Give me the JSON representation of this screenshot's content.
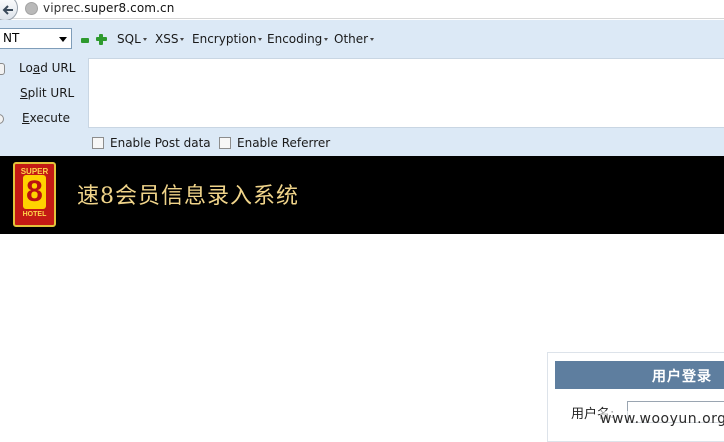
{
  "browser": {
    "url_prefix": "viprec.",
    "url_host": "super8.com.cn"
  },
  "hackbar": {
    "select_value": "NT",
    "menus": {
      "sql": "SQL",
      "xss": "XSS",
      "encryption": "Encryption",
      "encoding": "Encoding",
      "other": "Other"
    },
    "actions": {
      "load_pre": "Lo",
      "load_ul": "a",
      "load_post": "d URL",
      "split_ul": "S",
      "split_post": "plit URL",
      "exec_ul": "E",
      "exec_post": "xecute"
    },
    "textarea_value": "",
    "checkboxes": {
      "post_data": "Enable Post data",
      "referrer": "Enable Referrer"
    }
  },
  "site": {
    "logo_top": "SUPER",
    "logo_num": "8",
    "logo_bottom": "HOTEL",
    "title": "速8会员信息录入系统"
  },
  "login": {
    "title": "用户登录",
    "username_label": "用户名:"
  },
  "watermark": "www.wooyun.org",
  "colors": {
    "hackbar_bg": "#dce9f6",
    "header_bg": "#000000",
    "title_color": "#f0d48a",
    "login_head_bg": "#5e7e9f"
  }
}
